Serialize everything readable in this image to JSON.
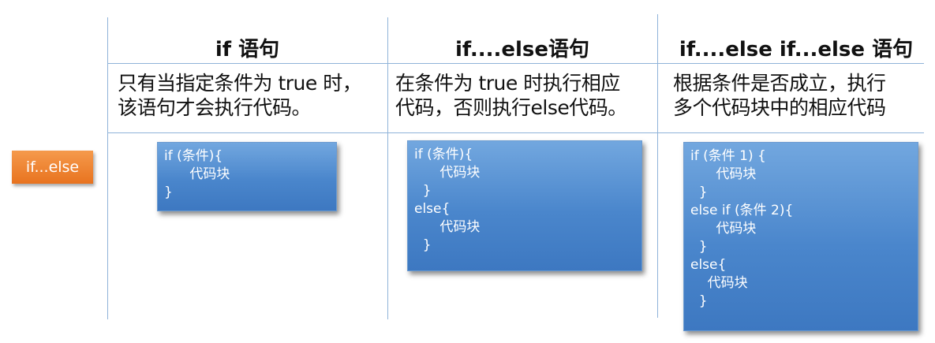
{
  "badge": "if...else",
  "columns": [
    {
      "title": "if 语句",
      "description": "只有当指定条件为 true 时，\n该语句才会执行代码。",
      "code": [
        "if (条件){",
        "      代码块",
        "}"
      ]
    },
    {
      "title": "if....else语句",
      "description": "在条件为 true 时执行相应\n代码，否则执行else代码。",
      "code": [
        "if (条件){",
        "      代码块",
        "  }",
        "else{",
        "      代码块",
        "  }"
      ]
    },
    {
      "title": "if....else if...else 语句",
      "description": "根据条件是否成立，执行\n多个代码块中的相应代码",
      "code": [
        "if (条件 1) {",
        "      代码块",
        "  }",
        "else if (条件 2){",
        "      代码块",
        "  }",
        "else{",
        "    代码块",
        "  }"
      ]
    }
  ]
}
